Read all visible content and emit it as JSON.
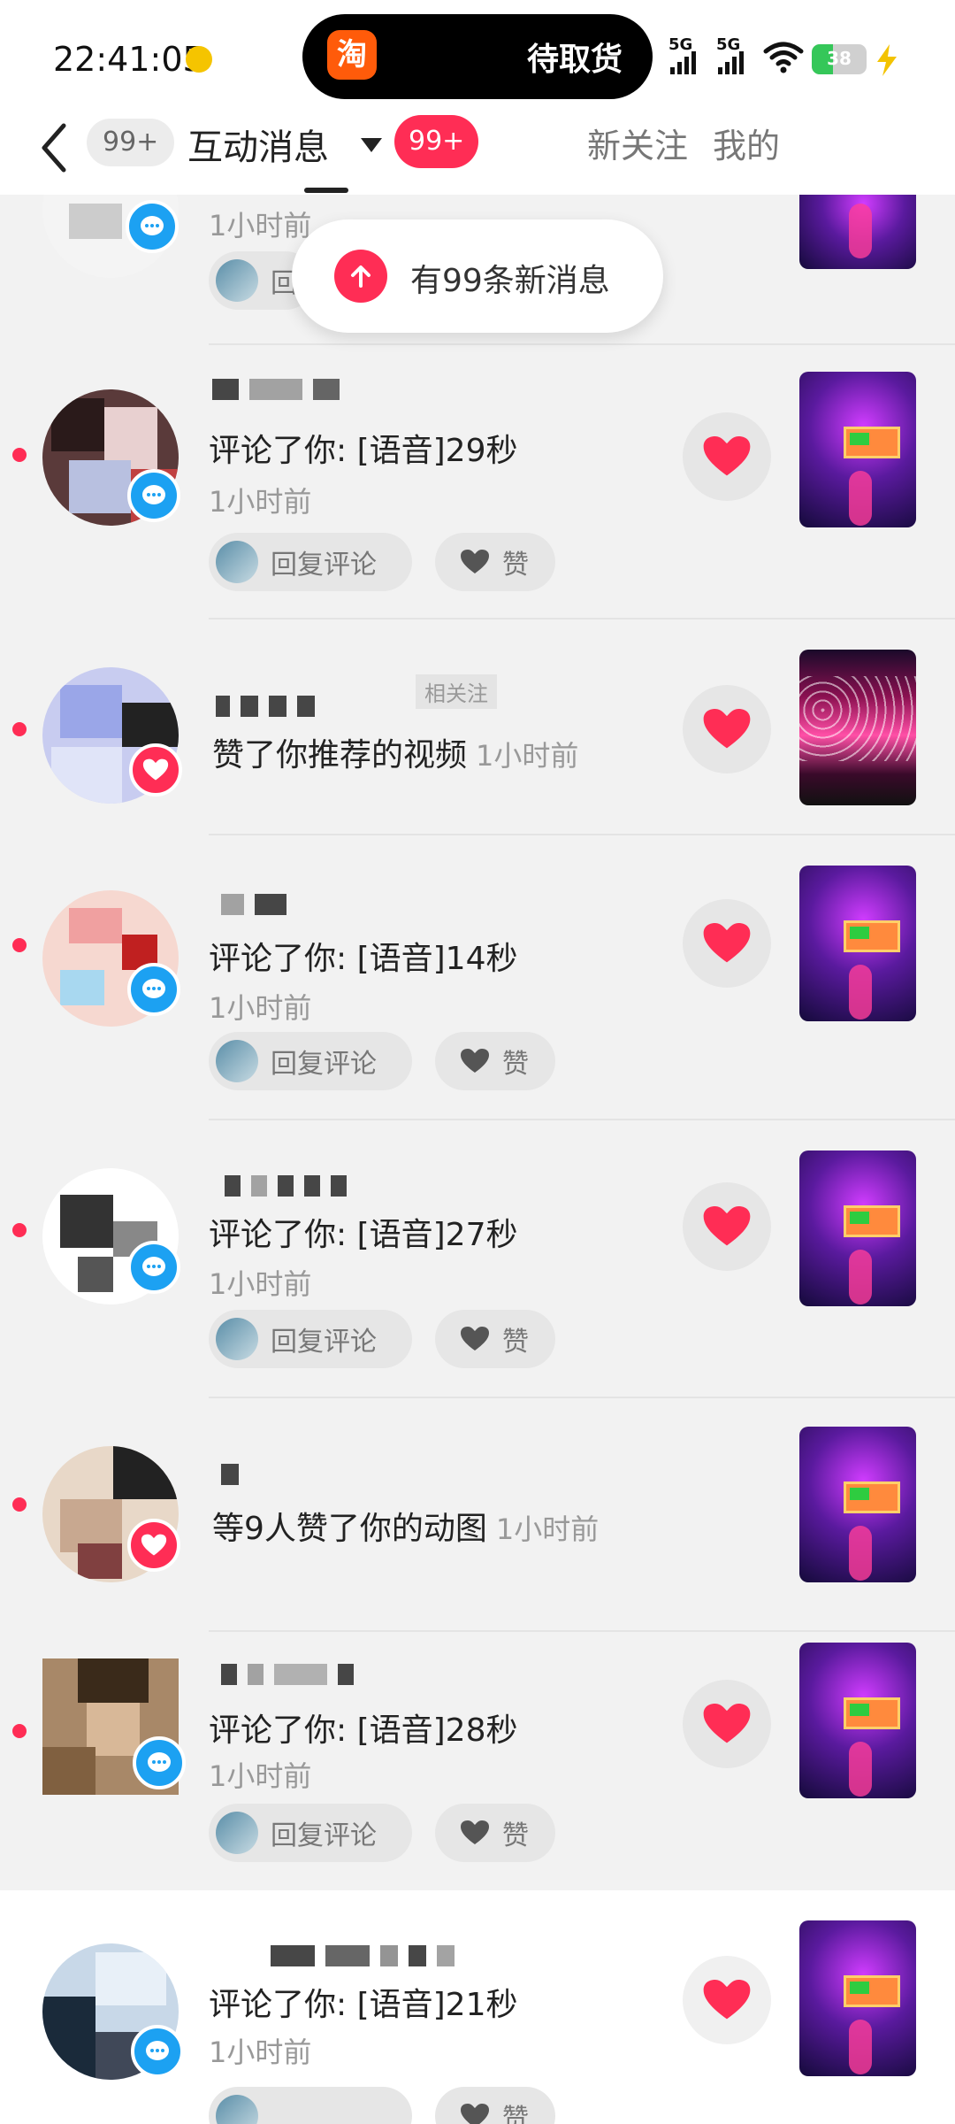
{
  "status_bar": {
    "time": "22:41:05",
    "pill_app": "淘",
    "pill_text": "待取货",
    "net1": "5G",
    "net2": "5G",
    "battery": "38",
    "battery_level": 0.38
  },
  "header": {
    "count_badge": "99+",
    "title": "互动消息",
    "unread_badge": "99+",
    "tab_follow": "新关注",
    "tab_mine": "我的"
  },
  "toast": {
    "text": "有99条新消息"
  },
  "rows": [
    {
      "when": "1小时前",
      "reply_label": "回"
    },
    {
      "action": "评论了你: [语音]29秒",
      "when": "1小时前",
      "reply_label": "回复评论",
      "like_label": "赞",
      "meta": ""
    },
    {
      "action": "赞了你推荐的视频",
      "meta": "1小时前",
      "name_tag": "相关注"
    },
    {
      "action": "评论了你: [语音]14秒",
      "when": "1小时前",
      "reply_label": "回复评论",
      "like_label": "赞"
    },
    {
      "action": "评论了你: [语音]27秒",
      "when": "1小时前",
      "reply_label": "回复评论",
      "like_label": "赞"
    },
    {
      "action": "等9人赞了你的动图",
      "meta": "1小时前"
    },
    {
      "action": "评论了你: [语音]28秒",
      "when": "1小时前",
      "reply_label": "回复评论",
      "like_label": "赞"
    },
    {
      "action": "评论了你: [语音]21秒",
      "when": "1小时前",
      "like_label": "赞"
    }
  ],
  "colors": {
    "accent": "#ff2d55",
    "comment_badge": "#1ca1f2",
    "background": "#f2f2f2"
  }
}
